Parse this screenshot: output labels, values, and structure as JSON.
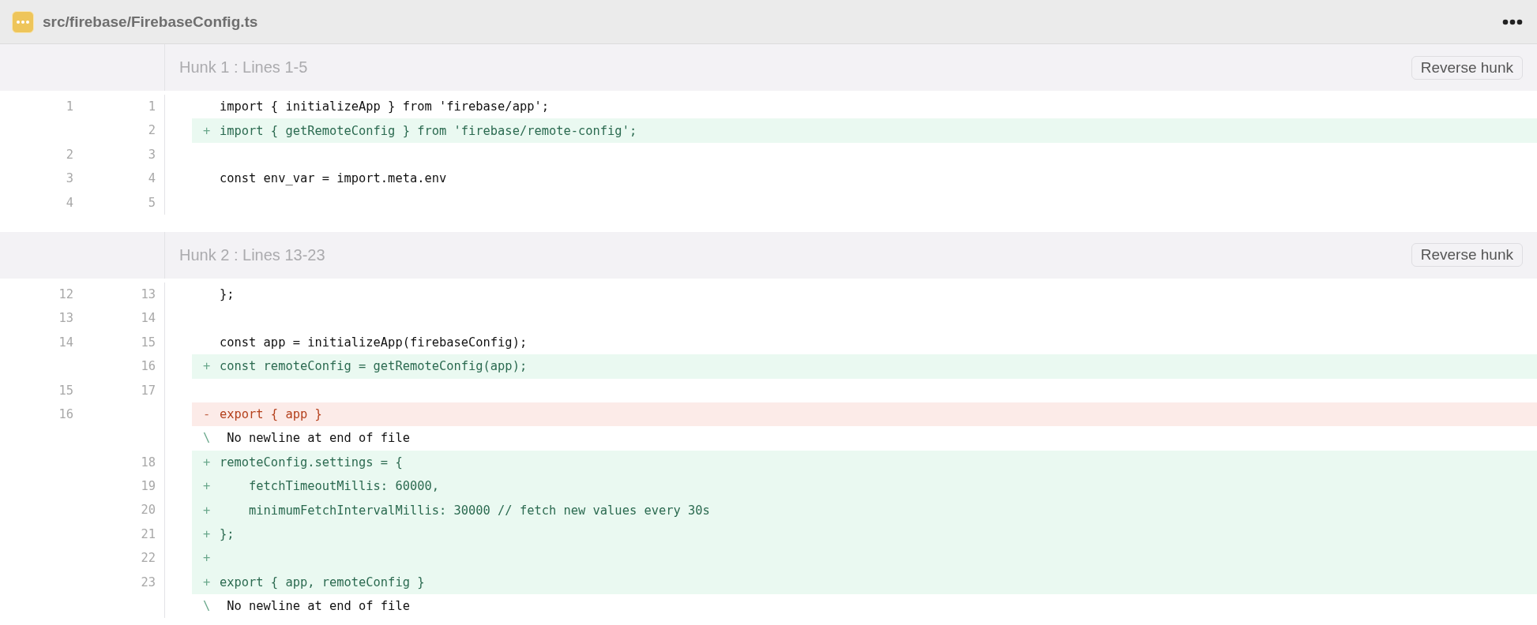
{
  "file": {
    "path": "src/firebase/FirebaseConfig.ts"
  },
  "hunks": [
    {
      "title": "Hunk 1 : Lines 1-5",
      "button": "Reverse hunk",
      "lines": [
        {
          "kind": "context",
          "old": "1",
          "new": "1",
          "text": "import { initializeApp } from 'firebase/app';"
        },
        {
          "kind": "add",
          "new": "2",
          "marker": "+",
          "text": "import { getRemoteConfig } from 'firebase/remote-config';"
        },
        {
          "kind": "context",
          "old": "2",
          "new": "3"
        },
        {
          "kind": "context",
          "old": "3",
          "new": "4",
          "text": "const env_var = import.meta.env"
        },
        {
          "kind": "context",
          "old": "4",
          "new": "5"
        }
      ]
    },
    {
      "title": "Hunk 2 : Lines 13-23",
      "button": "Reverse hunk",
      "lines": [
        {
          "kind": "context",
          "old": "12",
          "new": "13",
          "text": "};"
        },
        {
          "kind": "context",
          "old": "13",
          "new": "14"
        },
        {
          "kind": "context",
          "old": "14",
          "new": "15",
          "text": "const app = initializeApp(firebaseConfig);"
        },
        {
          "kind": "add",
          "new": "16",
          "marker": "+",
          "text": "const remoteConfig = getRemoteConfig(app);"
        },
        {
          "kind": "context",
          "old": "15",
          "new": "17"
        },
        {
          "kind": "del",
          "old": "16",
          "marker": "-",
          "text": "export { app }"
        },
        {
          "kind": "note",
          "marker": "\\",
          "text": "No newline at end of file"
        },
        {
          "kind": "add",
          "new": "18",
          "marker": "+",
          "text": "remoteConfig.settings = {"
        },
        {
          "kind": "add",
          "new": "19",
          "marker": "+",
          "text": "    fetchTimeoutMillis: 60000,"
        },
        {
          "kind": "add",
          "new": "20",
          "marker": "+",
          "text": "    minimumFetchIntervalMillis: 30000 // fetch new values every 30s"
        },
        {
          "kind": "add",
          "new": "21",
          "marker": "+",
          "text": "};"
        },
        {
          "kind": "add",
          "new": "22",
          "marker": "+"
        },
        {
          "kind": "add",
          "new": "23",
          "marker": "+",
          "text": "export { app, remoteConfig }"
        },
        {
          "kind": "note",
          "marker": "\\",
          "text": "No newline at end of file"
        }
      ]
    }
  ]
}
